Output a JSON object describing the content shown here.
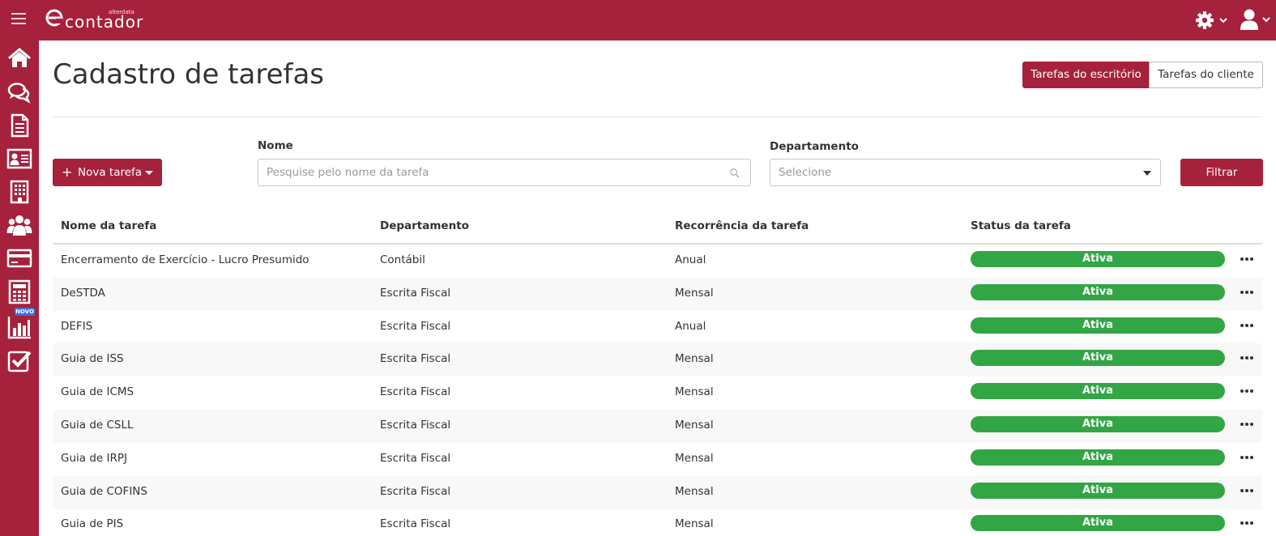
{
  "brand": {
    "name": "contador",
    "vendor": "alterdata"
  },
  "colors": {
    "primary": "#a6213b",
    "status_active": "#32a645",
    "badge": "#3a6fd8"
  },
  "header": {
    "icons": [
      "menu-icon",
      "gear-icon",
      "user-icon"
    ]
  },
  "sidebar": {
    "items": [
      {
        "name": "home-icon"
      },
      {
        "name": "chat-icon"
      },
      {
        "name": "document-icon"
      },
      {
        "name": "contact-card-icon"
      },
      {
        "name": "building-icon"
      },
      {
        "name": "users-icon"
      },
      {
        "name": "credit-card-icon"
      },
      {
        "name": "calculator-icon"
      },
      {
        "name": "bar-chart-icon",
        "badge": "NOVO"
      },
      {
        "name": "checkbox-icon"
      }
    ]
  },
  "page": {
    "title": "Cadastro de tarefas"
  },
  "tabs": [
    {
      "label": "Tarefas do escritório",
      "active": true
    },
    {
      "label": "Tarefas do cliente",
      "active": false
    }
  ],
  "filters": {
    "new_task_label": "Nova tarefa",
    "name_label": "Nome",
    "name_placeholder": "Pesquise pelo nome da tarefa",
    "department_label": "Departamento",
    "department_value": "Selecione",
    "filter_button": "Filtrar"
  },
  "table": {
    "columns": [
      "Nome da tarefa",
      "Departamento",
      "Recorrência da tarefa",
      "Status da tarefa"
    ],
    "rows": [
      {
        "name": "Encerramento de Exercício - Lucro Presumido",
        "department": "Contábil",
        "recurrence": "Anual",
        "status": "Ativa"
      },
      {
        "name": "DeSTDA",
        "department": "Escrita Fiscal",
        "recurrence": "Mensal",
        "status": "Ativa"
      },
      {
        "name": "DEFIS",
        "department": "Escrita Fiscal",
        "recurrence": "Anual",
        "status": "Ativa"
      },
      {
        "name": "Guia de ISS",
        "department": "Escrita Fiscal",
        "recurrence": "Mensal",
        "status": "Ativa"
      },
      {
        "name": "Guia de ICMS",
        "department": "Escrita Fiscal",
        "recurrence": "Mensal",
        "status": "Ativa"
      },
      {
        "name": "Guia de CSLL",
        "department": "Escrita Fiscal",
        "recurrence": "Mensal",
        "status": "Ativa"
      },
      {
        "name": "Guia de IRPJ",
        "department": "Escrita Fiscal",
        "recurrence": "Mensal",
        "status": "Ativa"
      },
      {
        "name": "Guia de COFINS",
        "department": "Escrita Fiscal",
        "recurrence": "Mensal",
        "status": "Ativa"
      },
      {
        "name": "Guia de PIS",
        "department": "Escrita Fiscal",
        "recurrence": "Mensal",
        "status": "Ativa"
      }
    ]
  }
}
